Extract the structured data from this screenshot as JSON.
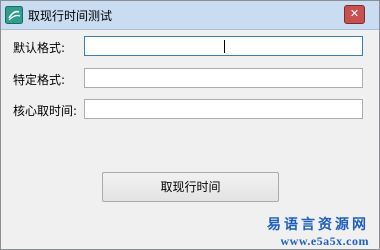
{
  "window": {
    "title": "取现行时间测试",
    "close_glyph": "✕",
    "icon": "app-icon"
  },
  "form": {
    "fields": [
      {
        "label": "默认格式:",
        "value": ""
      },
      {
        "label": "特定格式:",
        "value": ""
      },
      {
        "label": "核心取时间:",
        "value": ""
      }
    ]
  },
  "actions": {
    "get_time_label": "取现行时间"
  },
  "watermark": {
    "name": "易语言资源网",
    "url": "www.e5a5x.com"
  }
}
